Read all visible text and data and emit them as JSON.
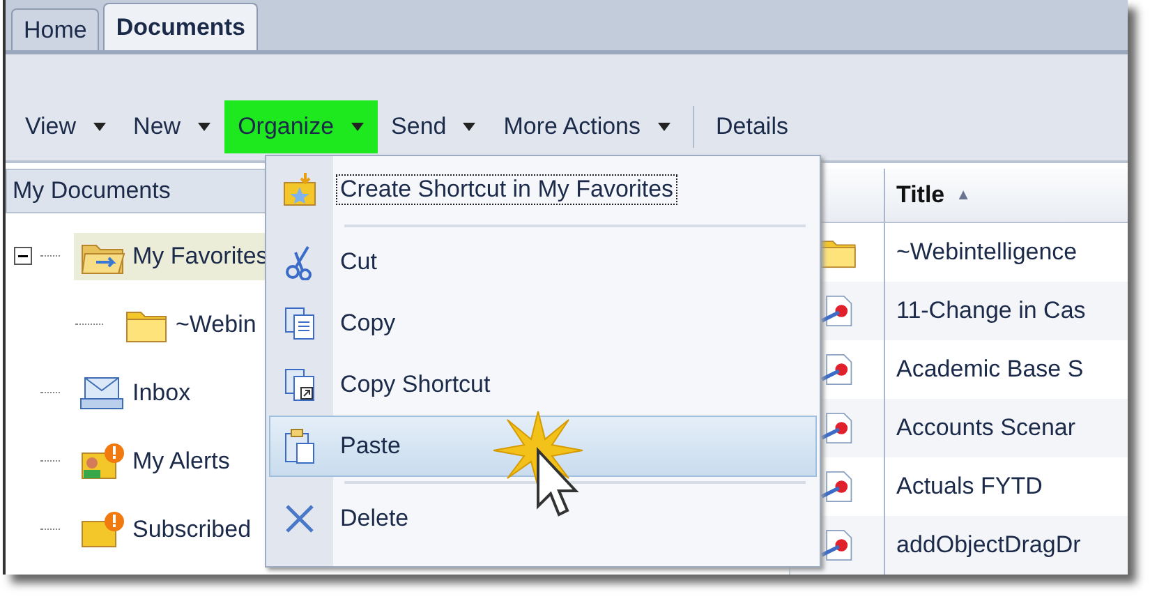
{
  "tabs": [
    {
      "label": "Home",
      "selected": false
    },
    {
      "label": "Documents",
      "selected": true
    }
  ],
  "toolbar": [
    {
      "kind": "menu",
      "label": "View",
      "highlighted": false
    },
    {
      "kind": "menu",
      "label": "New",
      "highlighted": false
    },
    {
      "kind": "menu",
      "label": "Organize",
      "highlighted": true
    },
    {
      "kind": "menu",
      "label": "Send",
      "highlighted": false
    },
    {
      "kind": "menu",
      "label": "More Actions",
      "highlighted": false
    },
    {
      "kind": "button",
      "label": "Details",
      "highlighted": false
    }
  ],
  "tree": {
    "header": "My Documents",
    "items": [
      {
        "kind": "favorites",
        "label": "My Favorites",
        "selected": true,
        "expanded": true,
        "children": [
          {
            "kind": "folder",
            "label": "~Webin",
            "selected": false
          }
        ]
      },
      {
        "kind": "inbox",
        "label": "Inbox",
        "selected": false
      },
      {
        "kind": "alerts",
        "label": "My Alerts",
        "selected": false
      },
      {
        "kind": "subscribed",
        "label": "Subscribed",
        "selected": false
      }
    ]
  },
  "table": {
    "columns": [
      {
        "label": "Title",
        "sort_indicator": "▲"
      }
    ],
    "rows": [
      {
        "kind": "folder",
        "title": "~Webintelligence"
      },
      {
        "kind": "document",
        "title": "11-Change in Cas"
      },
      {
        "kind": "document",
        "title": "Academic Base S"
      },
      {
        "kind": "document",
        "title": "Accounts Scenar"
      },
      {
        "kind": "document",
        "title": "Actuals FYTD"
      },
      {
        "kind": "document",
        "title": "addObjectDragDr"
      }
    ]
  },
  "menu": {
    "items": [
      {
        "kind": "create-shortcut",
        "label": "Create Shortcut in My Favorites",
        "focused": true,
        "selected": false
      },
      {
        "kind": "separator"
      },
      {
        "kind": "cut",
        "label": "Cut",
        "focused": false,
        "selected": false
      },
      {
        "kind": "copy",
        "label": "Copy",
        "focused": false,
        "selected": false
      },
      {
        "kind": "copy-shortcut",
        "label": "Copy Shortcut",
        "focused": false,
        "selected": false
      },
      {
        "kind": "paste",
        "label": "Paste",
        "focused": false,
        "selected": true
      },
      {
        "kind": "separator"
      },
      {
        "kind": "delete",
        "label": "Delete",
        "focused": false,
        "selected": false
      }
    ]
  }
}
